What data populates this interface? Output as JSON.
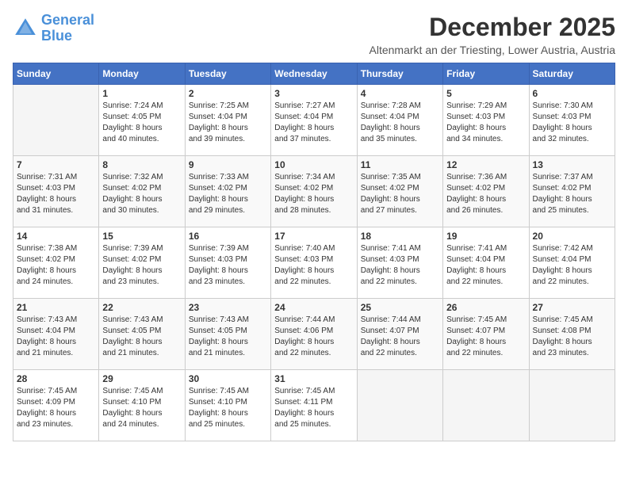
{
  "logo": {
    "line1": "General",
    "line2": "Blue"
  },
  "title": "December 2025",
  "subtitle": "Altenmarkt an der Triesting, Lower Austria, Austria",
  "days_of_week": [
    "Sunday",
    "Monday",
    "Tuesday",
    "Wednesday",
    "Thursday",
    "Friday",
    "Saturday"
  ],
  "weeks": [
    [
      {
        "day": "",
        "info": ""
      },
      {
        "day": "1",
        "info": "Sunrise: 7:24 AM\nSunset: 4:05 PM\nDaylight: 8 hours\nand 40 minutes."
      },
      {
        "day": "2",
        "info": "Sunrise: 7:25 AM\nSunset: 4:04 PM\nDaylight: 8 hours\nand 39 minutes."
      },
      {
        "day": "3",
        "info": "Sunrise: 7:27 AM\nSunset: 4:04 PM\nDaylight: 8 hours\nand 37 minutes."
      },
      {
        "day": "4",
        "info": "Sunrise: 7:28 AM\nSunset: 4:04 PM\nDaylight: 8 hours\nand 35 minutes."
      },
      {
        "day": "5",
        "info": "Sunrise: 7:29 AM\nSunset: 4:03 PM\nDaylight: 8 hours\nand 34 minutes."
      },
      {
        "day": "6",
        "info": "Sunrise: 7:30 AM\nSunset: 4:03 PM\nDaylight: 8 hours\nand 32 minutes."
      }
    ],
    [
      {
        "day": "7",
        "info": "Sunrise: 7:31 AM\nSunset: 4:03 PM\nDaylight: 8 hours\nand 31 minutes."
      },
      {
        "day": "8",
        "info": "Sunrise: 7:32 AM\nSunset: 4:02 PM\nDaylight: 8 hours\nand 30 minutes."
      },
      {
        "day": "9",
        "info": "Sunrise: 7:33 AM\nSunset: 4:02 PM\nDaylight: 8 hours\nand 29 minutes."
      },
      {
        "day": "10",
        "info": "Sunrise: 7:34 AM\nSunset: 4:02 PM\nDaylight: 8 hours\nand 28 minutes."
      },
      {
        "day": "11",
        "info": "Sunrise: 7:35 AM\nSunset: 4:02 PM\nDaylight: 8 hours\nand 27 minutes."
      },
      {
        "day": "12",
        "info": "Sunrise: 7:36 AM\nSunset: 4:02 PM\nDaylight: 8 hours\nand 26 minutes."
      },
      {
        "day": "13",
        "info": "Sunrise: 7:37 AM\nSunset: 4:02 PM\nDaylight: 8 hours\nand 25 minutes."
      }
    ],
    [
      {
        "day": "14",
        "info": "Sunrise: 7:38 AM\nSunset: 4:02 PM\nDaylight: 8 hours\nand 24 minutes."
      },
      {
        "day": "15",
        "info": "Sunrise: 7:39 AM\nSunset: 4:02 PM\nDaylight: 8 hours\nand 23 minutes."
      },
      {
        "day": "16",
        "info": "Sunrise: 7:39 AM\nSunset: 4:03 PM\nDaylight: 8 hours\nand 23 minutes."
      },
      {
        "day": "17",
        "info": "Sunrise: 7:40 AM\nSunset: 4:03 PM\nDaylight: 8 hours\nand 22 minutes."
      },
      {
        "day": "18",
        "info": "Sunrise: 7:41 AM\nSunset: 4:03 PM\nDaylight: 8 hours\nand 22 minutes."
      },
      {
        "day": "19",
        "info": "Sunrise: 7:41 AM\nSunset: 4:04 PM\nDaylight: 8 hours\nand 22 minutes."
      },
      {
        "day": "20",
        "info": "Sunrise: 7:42 AM\nSunset: 4:04 PM\nDaylight: 8 hours\nand 22 minutes."
      }
    ],
    [
      {
        "day": "21",
        "info": "Sunrise: 7:43 AM\nSunset: 4:04 PM\nDaylight: 8 hours\nand 21 minutes."
      },
      {
        "day": "22",
        "info": "Sunrise: 7:43 AM\nSunset: 4:05 PM\nDaylight: 8 hours\nand 21 minutes."
      },
      {
        "day": "23",
        "info": "Sunrise: 7:43 AM\nSunset: 4:05 PM\nDaylight: 8 hours\nand 21 minutes."
      },
      {
        "day": "24",
        "info": "Sunrise: 7:44 AM\nSunset: 4:06 PM\nDaylight: 8 hours\nand 22 minutes."
      },
      {
        "day": "25",
        "info": "Sunrise: 7:44 AM\nSunset: 4:07 PM\nDaylight: 8 hours\nand 22 minutes."
      },
      {
        "day": "26",
        "info": "Sunrise: 7:45 AM\nSunset: 4:07 PM\nDaylight: 8 hours\nand 22 minutes."
      },
      {
        "day": "27",
        "info": "Sunrise: 7:45 AM\nSunset: 4:08 PM\nDaylight: 8 hours\nand 23 minutes."
      }
    ],
    [
      {
        "day": "28",
        "info": "Sunrise: 7:45 AM\nSunset: 4:09 PM\nDaylight: 8 hours\nand 23 minutes."
      },
      {
        "day": "29",
        "info": "Sunrise: 7:45 AM\nSunset: 4:10 PM\nDaylight: 8 hours\nand 24 minutes."
      },
      {
        "day": "30",
        "info": "Sunrise: 7:45 AM\nSunset: 4:10 PM\nDaylight: 8 hours\nand 25 minutes."
      },
      {
        "day": "31",
        "info": "Sunrise: 7:45 AM\nSunset: 4:11 PM\nDaylight: 8 hours\nand 25 minutes."
      },
      {
        "day": "",
        "info": ""
      },
      {
        "day": "",
        "info": ""
      },
      {
        "day": "",
        "info": ""
      }
    ]
  ]
}
